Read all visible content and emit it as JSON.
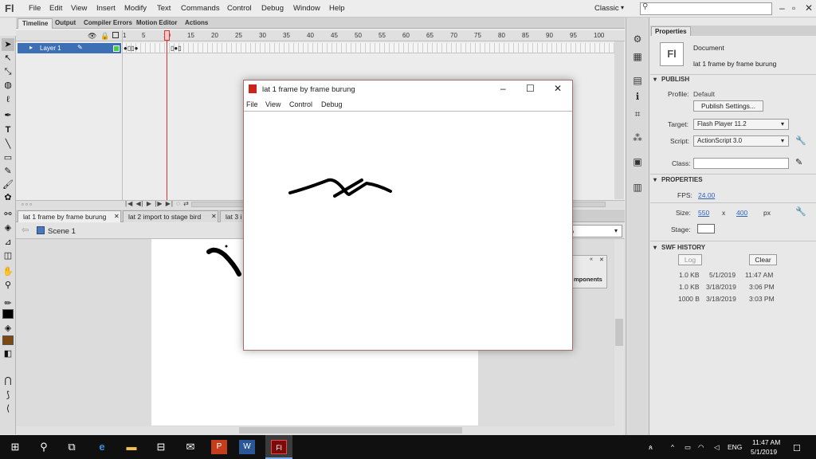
{
  "app": {
    "logo": "Fl",
    "menus": [
      "File",
      "Edit",
      "View",
      "Insert",
      "Modify",
      "Text",
      "Commands",
      "Control",
      "Debug",
      "Window",
      "Help"
    ],
    "workspace": "Classic",
    "search_placeholder": ""
  },
  "panel_tabs": [
    "Timeline",
    "Output",
    "Compiler Errors",
    "Motion Editor",
    "Actions"
  ],
  "timeline": {
    "frame_numbers": [
      "1",
      "5",
      "10",
      "15",
      "20",
      "25",
      "30",
      "35",
      "40",
      "45",
      "50",
      "55",
      "60",
      "65",
      "70",
      "75",
      "80",
      "85",
      "90",
      "95",
      "100"
    ],
    "current_frame": 10,
    "layer_name": "Layer 1"
  },
  "document_tabs": [
    "lat 1 frame by frame burung",
    "lat 2 import to stage bird",
    "lat 3 i"
  ],
  "edit_bar": {
    "scene": "Scene 1",
    "zoom": "%"
  },
  "components_panel": {
    "label": "mponents"
  },
  "properties": {
    "tab": "Properties",
    "doc_icon": "Fl",
    "doc_type": "Document",
    "doc_name": "lat 1 frame by frame burung",
    "publish_header": "PUBLISH",
    "profile_label": "Profile:",
    "profile_value": "Default",
    "publish_settings_button": "Publish Settings...",
    "target_label": "Target:",
    "target_value": "Flash Player 11.2",
    "script_label": "Script:",
    "script_value": "ActionScript 3.0",
    "class_label": "Class:",
    "properties_header": "PROPERTIES",
    "fps_label": "FPS:",
    "fps_value": "24.00",
    "size_label": "Size:",
    "width": "550",
    "size_x": "x",
    "height": "400",
    "size_unit": "px",
    "stage_label": "Stage:",
    "swf_history_header": "SWF HISTORY",
    "log_button": "Log",
    "clear_button": "Clear",
    "history": [
      {
        "size": "1.0 KB",
        "date": "5/1/2019",
        "time": "11:47 AM"
      },
      {
        "size": "1.0 KB",
        "date": "3/18/2019",
        "time": "3:06 PM"
      },
      {
        "size": "1000 B",
        "date": "3/18/2019",
        "time": "3:03 PM"
      }
    ]
  },
  "swf_player": {
    "title": "lat 1 frame by frame burung",
    "menus": [
      "File",
      "View",
      "Control",
      "Debug"
    ]
  },
  "taskbar": {
    "language": "ENG",
    "time": "11:47 AM",
    "date": "5/1/2019"
  },
  "colors": {
    "accent_blue": "#3d6fb5",
    "playhead_red": "#dd3333",
    "fill_color": "#7a4a12",
    "stroke_color": "#000000"
  }
}
